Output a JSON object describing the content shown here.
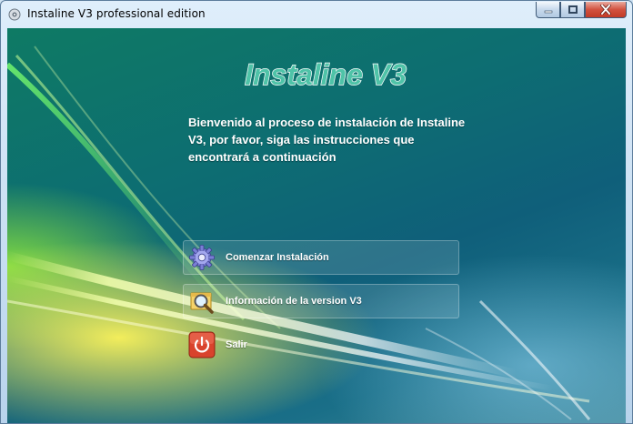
{
  "window": {
    "title": "Instaline V3 professional edition"
  },
  "logo": {
    "text": "Instaline V3"
  },
  "welcome_text": "Bienvenido al proceso de instalación de Instaline V3, por favor, siga las instrucciones que encontrará a continuación",
  "buttons": [
    {
      "label": "Comenzar Instalación",
      "icon": "gear-icon"
    },
    {
      "label": "Información de la version V3",
      "icon": "magnifier-icon"
    },
    {
      "label": "Salir",
      "icon": "power-icon"
    }
  ],
  "colors": {
    "title_text": "#000000",
    "close_button": "#c23b26",
    "logo_fill": "#4fc3a8",
    "text": "#ffffff"
  }
}
